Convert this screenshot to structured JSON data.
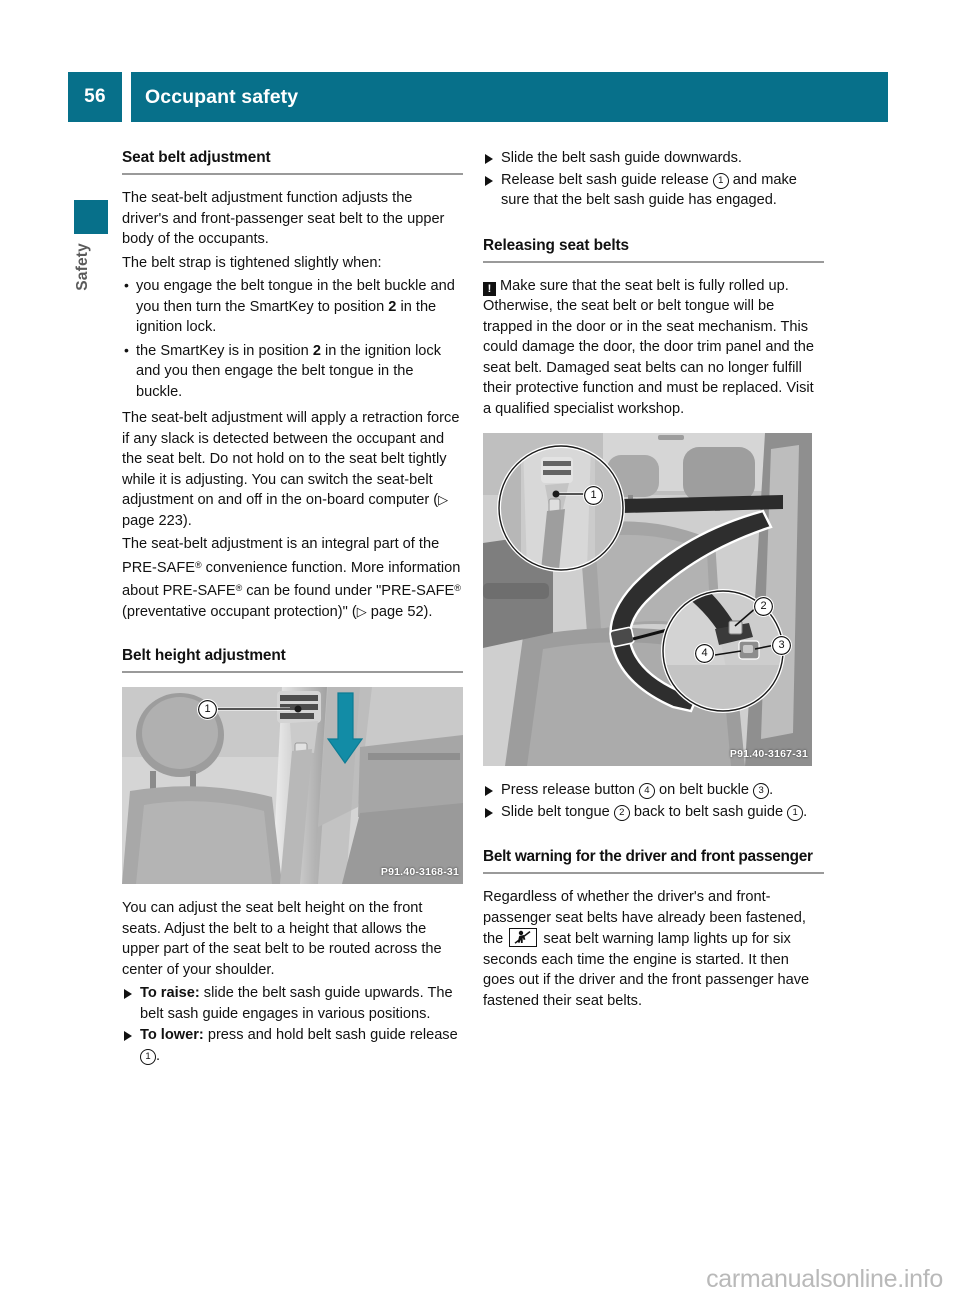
{
  "header": {
    "page_number": "56",
    "title": "Occupant safety",
    "accent_color": "#07708a"
  },
  "side_tab": {
    "label": "Safety"
  },
  "left_column": {
    "section1_heading": "Seat belt adjustment",
    "p1": "The seat-belt adjustment function adjusts the driver's and front-passenger seat belt to the upper body of the occupants.",
    "p2": "The belt strap is tightened slightly when:",
    "bullet1_a": "you engage the belt tongue in the belt buckle and you then turn the SmartKey to position ",
    "bullet1_b": "2",
    "bullet1_c": " in the ignition lock.",
    "bullet2_a": "the SmartKey is in position ",
    "bullet2_b": "2",
    "bullet2_c": " in the ignition lock and you then engage the belt tongue in the buckle.",
    "p3_a": "The seat-belt adjustment will apply a retraction force if any slack is detected between the occupant and the seat belt. Do not hold on to the seat belt tightly while it is adjusting. You can switch the seat-belt adjustment on and off in the on-board computer (",
    "p3_ref": " page 223).",
    "p4_a": "The seat-belt adjustment is an integral part of the PRE-SAFE",
    "p4_b": " convenience function. More information about PRE-SAFE",
    "p4_c": " can be found under \"PRE-SAFE",
    "p4_d": " (preventative occupant protection)\" (",
    "p4_ref": " page 52).",
    "registered_mark": "®",
    "section2_heading": "Belt height adjustment",
    "figure1_caption": "P91.40-3168-31",
    "figure1_callout1": "1",
    "p5": "You can adjust the seat belt height on the front seats. Adjust the belt to a height that allows the upper part of the seat belt to be routed across the center of your shoulder.",
    "step1_bold": "To raise:",
    "step1_text": " slide the belt sash guide upwards. The belt sash guide engages in various positions.",
    "step2_bold": "To lower:",
    "step2_text_a": " press and hold belt sash guide release ",
    "step2_circ": "1",
    "step2_text_b": "."
  },
  "right_column": {
    "step1_text": "Slide the belt sash guide downwards.",
    "step2_text_a": "Release belt sash guide release ",
    "step2_circ": "1",
    "step2_text_b": " and make sure that the belt sash guide has engaged.",
    "section1_heading": "Releasing seat belts",
    "warning_marker": "!",
    "warning_text": "Make sure that the seat belt is fully rolled up. Otherwise, the seat belt or belt tongue will be trapped in the door or in the seat mechanism. This could damage the door, the door trim panel and the seat belt. Damaged seat belts can no longer fulfill their protective function and must be replaced. Visit a qualified specialist workshop.",
    "figure2_caption": "P91.40-3167-31",
    "figure2_callout1": "1",
    "figure2_callout2": "2",
    "figure2_callout3": "3",
    "figure2_callout4": "4",
    "step3_text_a": "Press release button ",
    "step3_circ1": "4",
    "step3_text_b": " on belt buckle ",
    "step3_circ2": "3",
    "step3_text_c": ".",
    "step4_text_a": "Slide belt tongue ",
    "step4_circ1": "2",
    "step4_text_b": " back to belt sash guide ",
    "step4_circ2": "1",
    "step4_text_c": ".",
    "section2_heading": "Belt warning for the driver and front passenger",
    "p1_a": "Regardless of whether the driver's and front-passenger seat belts have already been fastened, the ",
    "p1_b": " seat belt warning lamp lights up for six seconds each time the engine is started. It then goes out if the driver and the front passenger have fastened their seat belts."
  },
  "watermark": {
    "text": "carmanualsonline.info"
  }
}
